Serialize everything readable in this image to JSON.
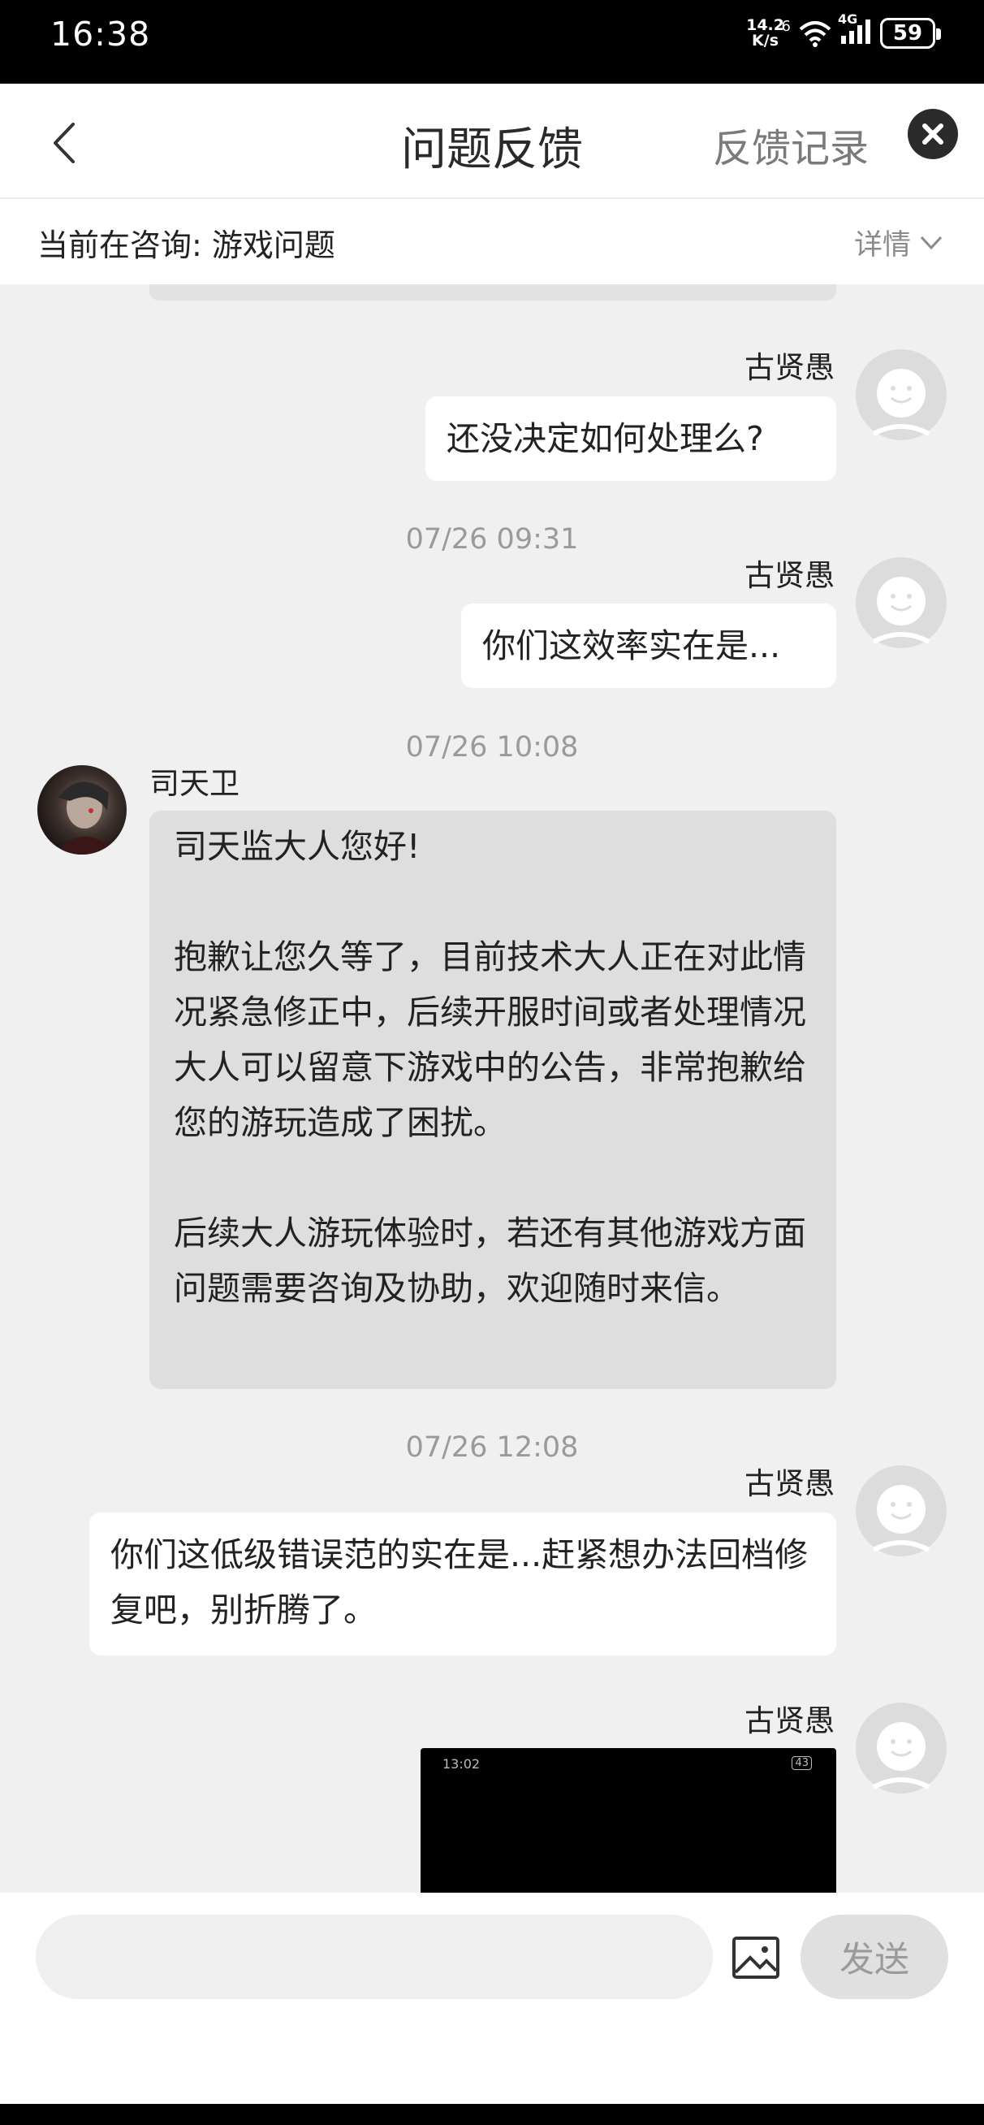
{
  "status": {
    "time": "16:38",
    "net_speed_top": "14.2",
    "net_speed_bottom": "K/s",
    "net_type": "4G",
    "sim": "6",
    "battery": "59"
  },
  "nav": {
    "title": "问题反馈",
    "history": "反馈记录"
  },
  "topic": {
    "label": "当前在咨询: 游戏问题",
    "detail": "详情"
  },
  "messages": [
    {
      "sender": "古贤愚",
      "text": "还没决定如何处理么?"
    },
    {
      "time": "07/26 09:31",
      "sender": "古贤愚",
      "text": "你们这效率实在是..."
    },
    {
      "time": "07/26 10:08",
      "sender": "司天卫",
      "paragraphs": [
        "司天监大人您好!",
        "抱歉让您久等了，目前技术大人正在对此情况紧急修正中，后续开服时间或者处理情况大人可以留意下游戏中的公告，非常抱歉给您的游玩造成了困扰。",
        "后续大人游玩体验时，若还有其他游戏方面问题需要咨询及协助，欢迎随时来信。"
      ]
    },
    {
      "time": "07/26 12:08",
      "sender": "古贤愚",
      "text": "你们这低级错误范的实在是...赶紧想办法回档修复吧，别折腾了。"
    },
    {
      "sender": "古贤愚",
      "image_time": "13:02",
      "image_battery": "43"
    }
  ],
  "input": {
    "placeholder": "",
    "send_label": "发送"
  },
  "colors": {
    "chat_bg": "#f0f0f0",
    "agent_bubble": "#dedede",
    "user_bubble": "#ffffff"
  }
}
